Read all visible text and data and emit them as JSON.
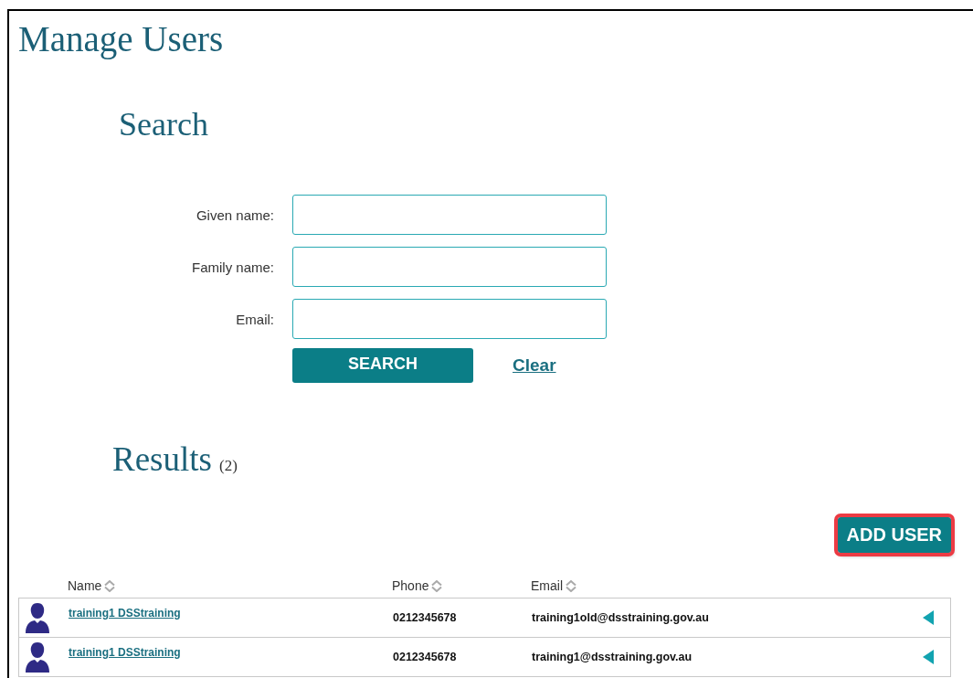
{
  "title": "Manage Users",
  "search": {
    "heading": "Search",
    "fields": [
      {
        "label": "Given name:"
      },
      {
        "label": "Family name:"
      },
      {
        "label": "Email:"
      }
    ],
    "search_button": "SEARCH",
    "clear_link": "Clear"
  },
  "results": {
    "heading": "Results",
    "count": "(2)",
    "add_button": "ADD USER",
    "add_button_highlighted": true,
    "columns": [
      "Name",
      "Phone",
      "Email"
    ],
    "rows": [
      {
        "name": "training1 DSStraining",
        "phone": "0212345678",
        "email": "training1old@dsstraining.gov.au"
      },
      {
        "name": "training1 DSStraining",
        "phone": "0212345678",
        "email": "training1@dsstraining.gov.au"
      }
    ]
  }
}
